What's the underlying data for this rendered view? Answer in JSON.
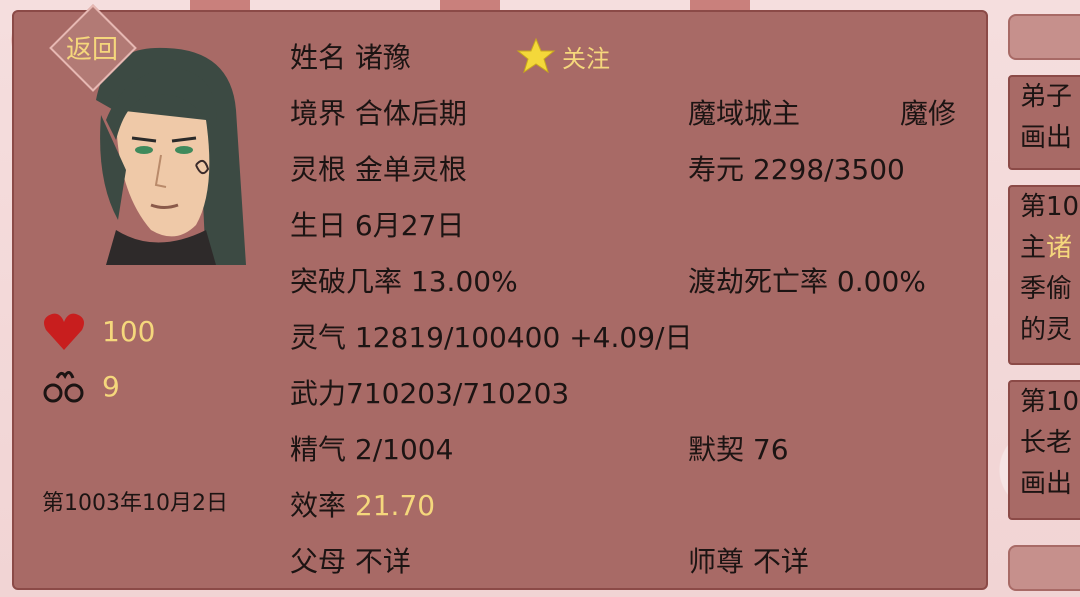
{
  "back_label": "返回",
  "follow_label": "关注",
  "character": {
    "name_label": "姓名",
    "name": "诸豫",
    "realm_label": "境界",
    "realm": "合体后期",
    "title": "魔域城主",
    "class": "魔修",
    "root_label": "灵根",
    "root": "金单灵根",
    "lifespan_label": "寿元",
    "lifespan": "2298/3500",
    "birthday_label": "生日",
    "birthday": "6月27日",
    "breakthrough_label": "突破几率",
    "breakthrough": "13.00%",
    "tribulation_label": "渡劫死亡率",
    "tribulation": "0.00%",
    "qi_label": "灵气",
    "qi": "12819/100400 +4.09/日",
    "force_label": "武力",
    "force": "710203/710203",
    "essence_label": "精气",
    "essence": "2/1004",
    "bond_label": "默契",
    "bond": "76",
    "efficiency_label": "效率",
    "efficiency": "21.70",
    "parents_label": "父母",
    "parents": "不详",
    "master_label": "师尊",
    "master": "不详"
  },
  "side_stats": {
    "health_value": "100",
    "shackles_value": "9"
  },
  "date": "第1003年10月2日",
  "right_log": {
    "entry1_lines": [
      "弟子",
      "画出"
    ],
    "entry2_lines": [
      "第10",
      "主诸",
      "季偷",
      "的灵"
    ],
    "entry3_lines": [
      "第10",
      "长老",
      "画出"
    ]
  },
  "colors": {
    "panel": "#a86a66",
    "highlight": "#f5d77c",
    "text": "#1c1413",
    "heart": "#c81e1e"
  }
}
